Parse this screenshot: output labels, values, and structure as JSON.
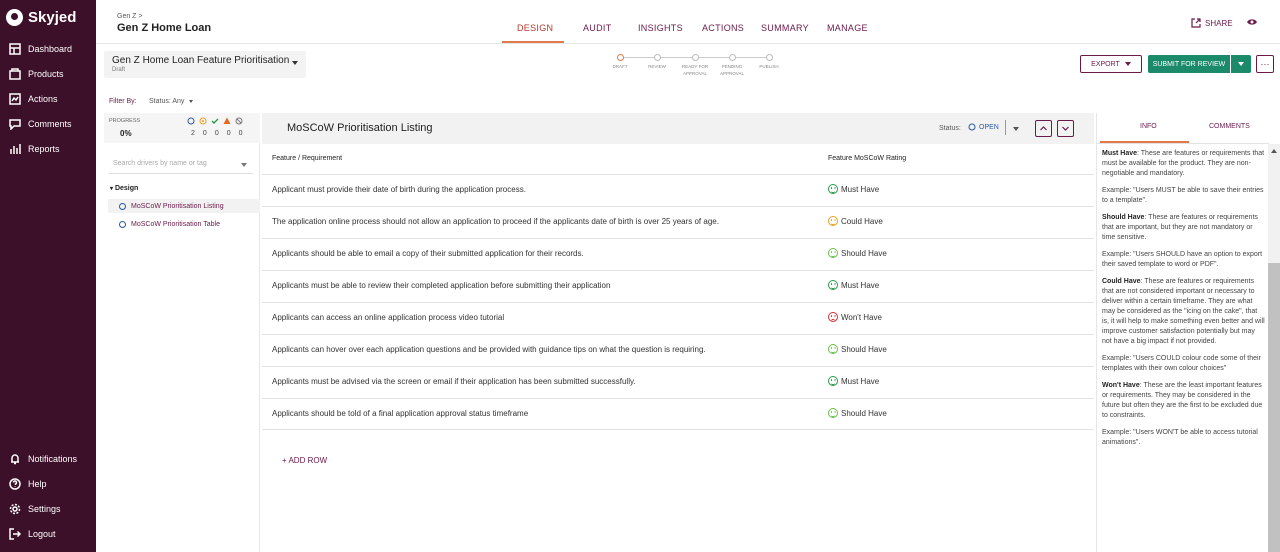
{
  "brand": {
    "name": "Skyjed"
  },
  "sidebar": {
    "items": [
      {
        "label": "Dashboard",
        "icon": "dashboard-icon"
      },
      {
        "label": "Products",
        "icon": "products-icon"
      },
      {
        "label": "Actions",
        "icon": "actions-icon"
      },
      {
        "label": "Comments",
        "icon": "comments-icon"
      },
      {
        "label": "Reports",
        "icon": "reports-icon"
      }
    ],
    "bottom": [
      {
        "label": "Notifications",
        "icon": "bell-icon"
      },
      {
        "label": "Help",
        "icon": "help-icon"
      },
      {
        "label": "Settings",
        "icon": "gear-icon"
      },
      {
        "label": "Logout",
        "icon": "logout-icon"
      }
    ]
  },
  "header": {
    "breadcrumb": "Gen Z >",
    "title": "Gen Z Home Loan",
    "tabs": [
      "DESIGN",
      "AUDIT",
      "INSIGHTS",
      "ACTIONS",
      "SUMMARY",
      "MANAGE"
    ],
    "active_tab": "DESIGN",
    "share": "SHARE"
  },
  "document": {
    "title": "Gen Z Home Loan Feature Prioritisation",
    "status": "Draft"
  },
  "stepper": [
    {
      "label": "DRAFT"
    },
    {
      "label": "REVIEW"
    },
    {
      "label": "READY FOR APPROVAL"
    },
    {
      "label": "PENDING APPROVAL"
    },
    {
      "label": "PUBLISH"
    }
  ],
  "actions": {
    "export": "EXPORT",
    "submit": "SUBMIT FOR REVIEW",
    "more": "···"
  },
  "filter": {
    "label": "Filter By:",
    "status": "Status: Any"
  },
  "progress": {
    "label": "PROGRESS",
    "value": "0%",
    "counts": [
      "2",
      "0",
      "0",
      "0",
      "0"
    ]
  },
  "drivers": {
    "search_placeholder": "Search drivers by name or tag",
    "group": "Design",
    "items": [
      "MoSCoW Prioritisation Listing",
      "MoSCoW Prioritisation Table"
    ]
  },
  "main": {
    "title": "MoSCoW Prioritisation Listing",
    "status_label": "Status:",
    "status_value": "OPEN",
    "columns": [
      "Feature / Requirement",
      "Feature MoSCoW Rating"
    ],
    "rows": [
      {
        "req": "Applicant must provide their date of birth during the application process.",
        "rating": "Must Have",
        "color": "#2a9a4a"
      },
      {
        "req": "The application online process should not allow an application to proceed if the applicants date of birth is over 25 years of age.",
        "rating": "Could Have",
        "color": "#e8a020"
      },
      {
        "req": "Applicants should be able to email a copy of their submitted application for their records.",
        "rating": "Should Have",
        "color": "#6abf4a"
      },
      {
        "req": "Applicants must be able to review their completed application before submitting their application",
        "rating": "Must Have",
        "color": "#2a9a4a"
      },
      {
        "req": "Applicants can access an online application process video tutorial",
        "rating": "Won't Have",
        "color": "#d83030"
      },
      {
        "req": "Applicants can hover over each application questions and be provided with guidance tips on what the question is requiring.",
        "rating": "Should Have",
        "color": "#6abf4a"
      },
      {
        "req": "Applicants must be advised via the screen or email if their application has been submitted successfully.",
        "rating": "Must Have",
        "color": "#2a9a4a"
      },
      {
        "req": "Applicants should be told of a final application approval status timeframe",
        "rating": "Should Have",
        "color": "#6abf4a"
      }
    ],
    "add_row": "+ ADD ROW"
  },
  "right": {
    "tabs": [
      "INFO",
      "COMMENTS"
    ],
    "info": [
      {
        "term": "Must Have",
        "text": ": These are features or requirements that must be available for the product. They are non-negotiable and mandatory."
      },
      {
        "term": "",
        "text": "Example: \"Users MUST be able to save their entries to a template\"."
      },
      {
        "term": "Should Have",
        "text": ": These are features or requirements that are important, but they are not mandatory or time sensitive."
      },
      {
        "term": "",
        "text": "Example: \"Users SHOULD have an option to export their saved template to word or PDF\"."
      },
      {
        "term": "Could Have",
        "text": ": These are features or requirements that are not considered important or necessary to deliver within a certain timeframe.  They are what may be considered as the \"icing on the cake\", that is, it will help to make something even better and will improve customer satisfaction potentially but may not have a big impact if not provided."
      },
      {
        "term": "",
        "text": "Example: \"Users COULD colour code some of their templates with their own colour choices\""
      },
      {
        "term": "Won't Have",
        "text": ": These are the least important features or requirements. They may be considered in the future but often they are the first to be excluded due to constraints."
      },
      {
        "term": "",
        "text": "Example: \"Users WON'T be able to access tutorial animations\"."
      }
    ]
  }
}
